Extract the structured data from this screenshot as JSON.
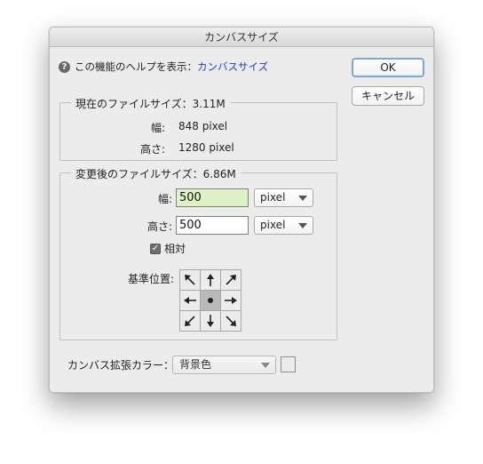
{
  "dialog": {
    "title": "カンバスサイズ",
    "help_text": "この機能のヘルプを表示：",
    "help_link": "カンバスサイズ",
    "help_icon_glyph": "?"
  },
  "buttons": {
    "ok": "OK",
    "cancel": "キャンセル"
  },
  "current": {
    "legend": "現在のファイルサイズ：3.11M",
    "width_label": "幅:",
    "width_value": "848 pixel",
    "height_label": "高さ:",
    "height_value": "1280 pixel"
  },
  "new_size": {
    "legend": "変更後のファイルサイズ：6.86M",
    "width_label": "幅:",
    "width_value": "500",
    "width_unit": "pixel",
    "height_label": "高さ:",
    "height_value": "500",
    "height_unit": "pixel",
    "relative_label": "相対",
    "relative_checked": true,
    "anchor_label": "基準位置:"
  },
  "extension": {
    "label": "カンバス拡張カラー：",
    "value": "背景色",
    "swatch_color": "#ececec"
  },
  "colors": {
    "active_field": "#dff2c5",
    "link": "#1a3fd1",
    "ok_focus": "#7aa7e0"
  }
}
